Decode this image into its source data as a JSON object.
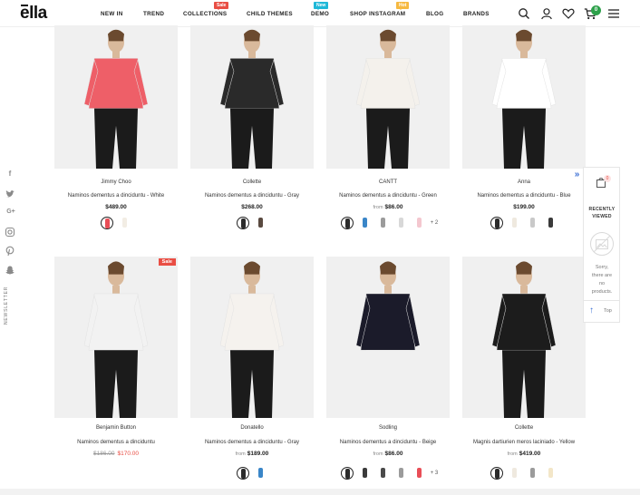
{
  "brand": {
    "logo_text": "ella"
  },
  "nav": [
    {
      "label": "NEW IN"
    },
    {
      "label": "TREND"
    },
    {
      "label": "COLLECTIONS",
      "badge": "Sale"
    },
    {
      "label": "CHILD THEMES"
    },
    {
      "label": "DEMO",
      "badge": "New"
    },
    {
      "label": "SHOP INSTAGRAM",
      "badge": "Hot"
    },
    {
      "label": "BLOG"
    },
    {
      "label": "BRANDS"
    }
  ],
  "header_icons": [
    "search-icon",
    "user-icon",
    "heart-icon",
    "cart-icon",
    "menu-icon"
  ],
  "cart": {
    "count": "0"
  },
  "social": [
    "facebook-icon",
    "twitter-icon",
    "google-plus-icon",
    "instagram-icon",
    "pinterest-icon",
    "snapchat-icon"
  ],
  "newsletter_label": "NEWSLETTER",
  "products": [
    {
      "vendor": "Jimmy Choo",
      "title": "Naminos dementus a dinciduntu - White",
      "price": "$489.00",
      "from": "",
      "old_price": "",
      "sale": false,
      "swatches": [
        "#e94e57",
        "#f2ede4"
      ],
      "more": ""
    },
    {
      "vendor": "Collette",
      "title": "Naminos dementus a dinciduntu - Gray",
      "price": "$268.00",
      "from": "",
      "old_price": "",
      "sale": false,
      "swatches": [
        "#2b2b2b",
        "#5a4a40"
      ],
      "more": ""
    },
    {
      "vendor": "CANTT",
      "title": "Naminos dementus a dinciduntu - Green",
      "price": "$86.00",
      "from": "from",
      "old_price": "",
      "sale": false,
      "swatches": [
        "#2b2b2b",
        "#3a86c8",
        "#9b9b9b",
        "#d8d8d8",
        "#f4c7cf"
      ],
      "more": "+ 2"
    },
    {
      "vendor": "Anna",
      "title": "Naminos dementus a dinciduntu - Blue",
      "price": "$199.00",
      "from": "",
      "old_price": "",
      "sale": false,
      "swatches": [
        "#2b2b2b",
        "#efe9df",
        "#c9c9c9",
        "#3a3a3a"
      ],
      "more": ""
    },
    {
      "vendor": "Benjamin Button",
      "title": "Naminos dementus a dinciduntu",
      "price": "$170.00",
      "from": "",
      "old_price": "$186.00",
      "sale": true,
      "sale_label": "Sale",
      "swatches": [],
      "more": ""
    },
    {
      "vendor": "Donatello",
      "title": "Naminos dementus a dinciduntu - Gray",
      "price": "$189.00",
      "from": "from",
      "old_price": "",
      "sale": false,
      "swatches": [
        "#2b2b2b",
        "#3a86c8"
      ],
      "more": ""
    },
    {
      "vendor": "Sodling",
      "title": "Naminos dementus a dinciduntu - Beige",
      "price": "$86.00",
      "from": "from",
      "old_price": "",
      "sale": false,
      "swatches": [
        "#2b2b2b",
        "#3b3b3b",
        "#4a4a4a",
        "#9b9b9b",
        "#e94e57"
      ],
      "more": "+ 3"
    },
    {
      "vendor": "Collette",
      "title": "Magnis dartiurien meros laciniado - Yellow",
      "price": "$419.00",
      "from": "from",
      "old_price": "",
      "sale": false,
      "swatches": [
        "#2b2b2b",
        "#efe9df",
        "#9b9b9b",
        "#f3e6c8"
      ],
      "more": ""
    }
  ],
  "recently_viewed": {
    "count": "0",
    "title_line1": "RECENTLY",
    "title_line2": "VIEWED",
    "msg_line1": "Sorry,",
    "msg_line2": "there are",
    "msg_line3": "no",
    "msg_line4": "products.",
    "top_label": "Top"
  },
  "colors": {
    "accent": "#e94e44",
    "new": "#1fb8d8",
    "hot": "#f6b941",
    "cart_badge": "#2ea14b",
    "link_blue": "#3b6fd4"
  }
}
